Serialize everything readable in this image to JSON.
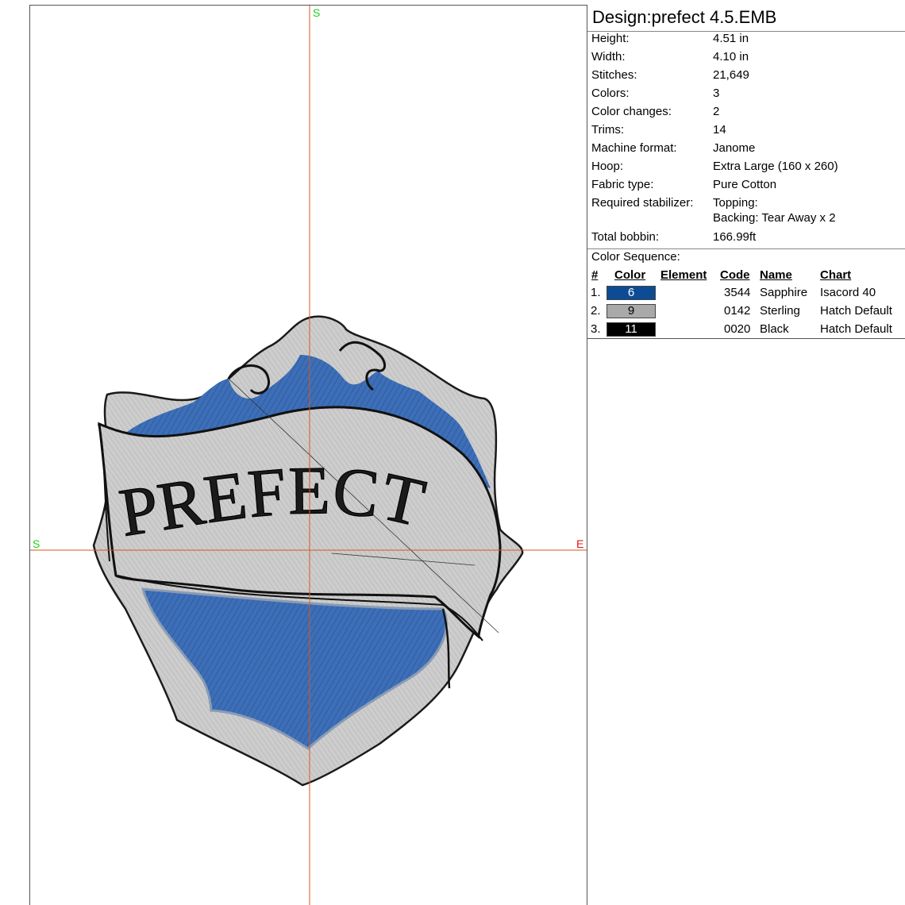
{
  "canvas": {
    "axis_labels": {
      "top": "S",
      "left": "S",
      "right": "E"
    },
    "badge_text": "PREFECT",
    "colors": {
      "shield_fill": "#3d6fb8",
      "frame_fill": "#c7c7c7",
      "outline": "#111111",
      "axis": "#d45a1e"
    }
  },
  "design": {
    "title": "Design:prefect 4.5.EMB",
    "properties": [
      {
        "key": "Height:",
        "value": "4.51 in"
      },
      {
        "key": "Width:",
        "value": "4.10 in"
      },
      {
        "key": "Stitches:",
        "value": "21,649"
      },
      {
        "key": "Colors:",
        "value": "3"
      },
      {
        "key": "Color changes:",
        "value": "2"
      },
      {
        "key": "Trims:",
        "value": "14"
      },
      {
        "key": "Machine format:",
        "value": "Janome"
      },
      {
        "key": "Hoop:",
        "value": "Extra Large (160 x 260)"
      },
      {
        "key": "Fabric type:",
        "value": "Pure Cotton"
      },
      {
        "key": "Required stabilizer:",
        "value": "Topping:",
        "value2": "Backing: Tear Away x 2"
      },
      {
        "key": "Total bobbin:",
        "value": "166.99ft"
      }
    ],
    "sequence_title": "Color Sequence:",
    "sequence_headers": {
      "num": "#",
      "color": "Color",
      "element": "Element",
      "code": "Code",
      "name": "Name",
      "chart": "Chart"
    },
    "sequence": [
      {
        "num": "1.",
        "swatch_label": "6",
        "swatch_color": "#0d4c94",
        "swatch_text_color": "#ffffff",
        "element": "",
        "code": "3544",
        "name": "Sapphire",
        "chart": "Isacord 40"
      },
      {
        "num": "2.",
        "swatch_label": "9",
        "swatch_color": "#a9a9a9",
        "swatch_text_color": "#000000",
        "element": "",
        "code": "0142",
        "name": "Sterling",
        "chart": "Hatch Default"
      },
      {
        "num": "3.",
        "swatch_label": "11",
        "swatch_color": "#000000",
        "swatch_text_color": "#ffffff",
        "element": "",
        "code": "0020",
        "name": "Black",
        "chart": "Hatch Default"
      }
    ]
  }
}
